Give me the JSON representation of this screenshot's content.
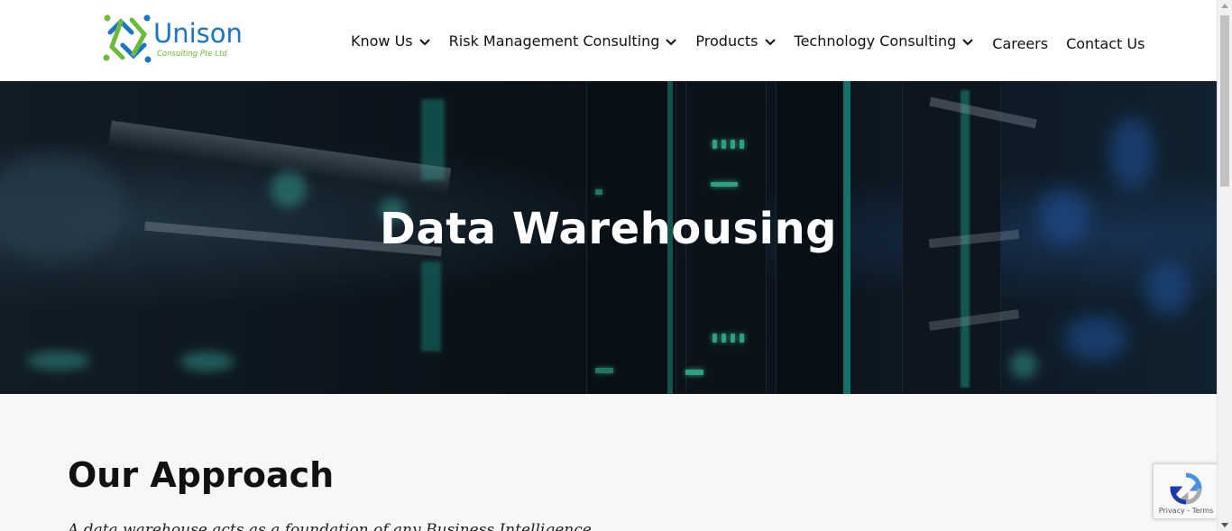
{
  "brand": {
    "name": "Unison",
    "tagline": "Consulting Pte Ltd",
    "colors": {
      "primary": "#1b74c4",
      "secondary": "#6dbb3a"
    }
  },
  "nav": {
    "items": [
      {
        "label": "Know Us",
        "has_dropdown": true
      },
      {
        "label": "Risk Management Consulting",
        "has_dropdown": true
      },
      {
        "label": "Products",
        "has_dropdown": true
      },
      {
        "label": "Technology Consulting",
        "has_dropdown": true
      },
      {
        "label": "Careers",
        "has_dropdown": false
      },
      {
        "label": "Contact Us",
        "has_dropdown": false
      }
    ]
  },
  "hero": {
    "title": "Data Warehousing",
    "background": "server-room-image"
  },
  "main": {
    "section_title": "Our Approach",
    "intro_text": "A data warehouse acts as a foundation of any Business Intelligence"
  },
  "recaptcha": {
    "links": "Privacy - Terms"
  }
}
